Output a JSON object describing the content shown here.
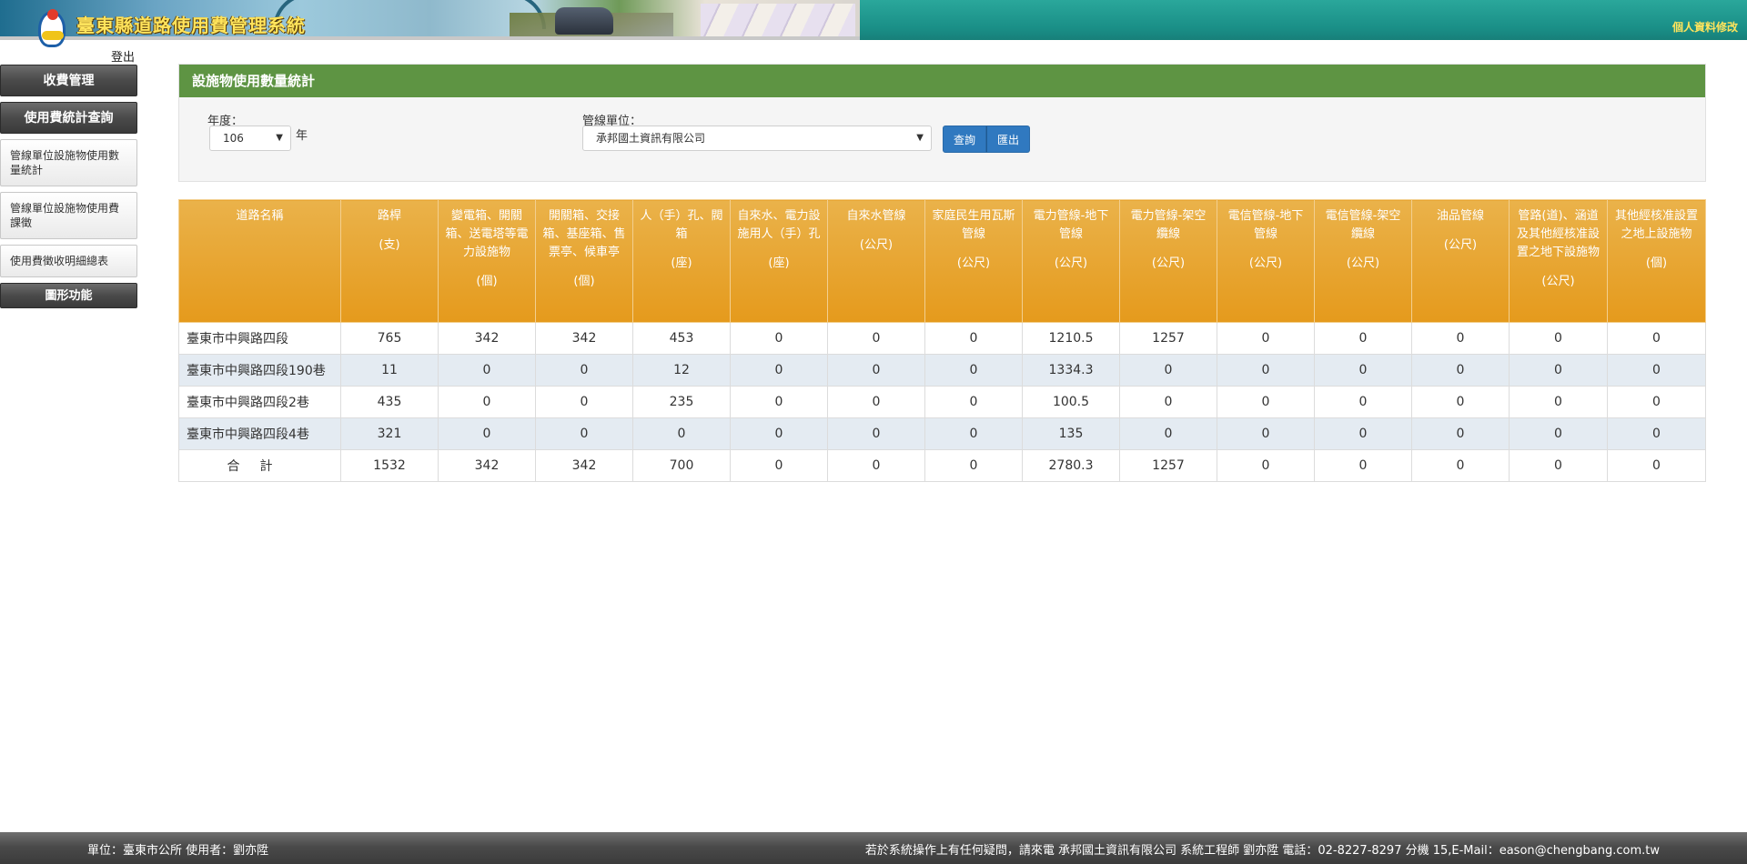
{
  "header": {
    "title": "臺東縣道路使用費管理系統",
    "profile_link": "個人資料修改",
    "logout": "登出"
  },
  "sidebar": {
    "items": [
      {
        "label": "收費管理"
      },
      {
        "label": "使用費統計查詢"
      },
      {
        "label": "管線單位設施物使用數量統計"
      },
      {
        "label": "管線單位設施物使用費課徵"
      },
      {
        "label": "使用費徵收明細總表"
      },
      {
        "label": "圖形功能"
      }
    ]
  },
  "panel": {
    "title": "設施物使用數量統計",
    "year_label": "年度：",
    "year_value": "106",
    "year_suffix": "年",
    "unit_label": "管線單位：",
    "unit_value": "承邦國土資訊有限公司",
    "query_button": "查詢",
    "export_button": "匯出"
  },
  "table": {
    "headers": [
      {
        "name": "道路名稱",
        "unit": ""
      },
      {
        "name": "路桿",
        "unit": "(支)"
      },
      {
        "name": "變電箱、開關箱、送電塔等電力設施物",
        "unit": "(個)"
      },
      {
        "name": "開關箱、交接箱、基座箱、售票亭、候車亭",
        "unit": "(個)"
      },
      {
        "name": "人（手）孔、閥箱",
        "unit": "(座)"
      },
      {
        "name": "自來水、電力設施用人（手）孔",
        "unit": "(座)"
      },
      {
        "name": "自來水管線",
        "unit": "(公尺)"
      },
      {
        "name": "家庭民生用瓦斯管線",
        "unit": "(公尺)"
      },
      {
        "name": "電力管線-地下管線",
        "unit": "(公尺)"
      },
      {
        "name": "電力管線-架空纜線",
        "unit": "(公尺)"
      },
      {
        "name": "電信管線-地下管線",
        "unit": "(公尺)"
      },
      {
        "name": "電信管線-架空纜線",
        "unit": "(公尺)"
      },
      {
        "name": "油品管線",
        "unit": "(公尺)"
      },
      {
        "name": "管路(道)、涵道及其他經核准設置之地下設施物",
        "unit": "(公尺)"
      },
      {
        "name": "其他經核准設置之地上設施物",
        "unit": "(個)"
      }
    ],
    "rows": [
      [
        "臺東市中興路四段",
        "765",
        "342",
        "342",
        "453",
        "0",
        "0",
        "0",
        "1210.5",
        "1257",
        "0",
        "0",
        "0",
        "0",
        "0"
      ],
      [
        "臺東市中興路四段190巷",
        "11",
        "0",
        "0",
        "12",
        "0",
        "0",
        "0",
        "1334.3",
        "0",
        "0",
        "0",
        "0",
        "0",
        "0"
      ],
      [
        "臺東市中興路四段2巷",
        "435",
        "0",
        "0",
        "235",
        "0",
        "0",
        "0",
        "100.5",
        "0",
        "0",
        "0",
        "0",
        "0",
        "0"
      ],
      [
        "臺東市中興路四段4巷",
        "321",
        "0",
        "0",
        "0",
        "0",
        "0",
        "0",
        "135",
        "0",
        "0",
        "0",
        "0",
        "0",
        "0"
      ]
    ],
    "total_label": "合計",
    "totals": [
      "1532",
      "342",
      "342",
      "700",
      "0",
      "0",
      "0",
      "2780.3",
      "1257",
      "0",
      "0",
      "0",
      "0",
      "0"
    ]
  },
  "footer": {
    "left": "單位：臺東市公所 使用者：劉亦陞",
    "right": "若於系統操作上有任何疑問，請來電 承邦國土資訊有限公司 系統工程師 劉亦陞 電話：02-8227-8297 分機 15,E-Mail：eason@chengbang.com.tw"
  }
}
